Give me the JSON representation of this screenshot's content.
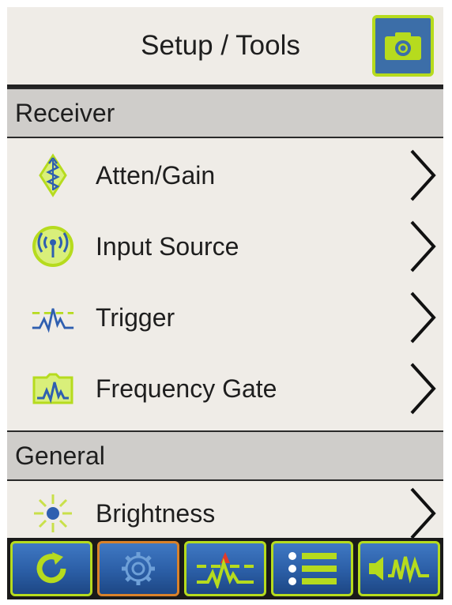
{
  "header": {
    "title": "Setup / Tools",
    "camera_icon": "camera-icon"
  },
  "sections": [
    {
      "label": "Receiver",
      "items": [
        {
          "label": "Atten/Gain",
          "icon": "atten-gain-icon"
        },
        {
          "label": "Input Source",
          "icon": "input-source-icon"
        },
        {
          "label": "Trigger",
          "icon": "trigger-icon"
        },
        {
          "label": "Frequency Gate",
          "icon": "frequency-gate-icon"
        }
      ]
    },
    {
      "label": "General",
      "items": [
        {
          "label": "Brightness",
          "icon": "brightness-icon"
        }
      ]
    }
  ],
  "toolbar": {
    "buttons": [
      {
        "icon": "refresh-icon",
        "active": false
      },
      {
        "icon": "gear-icon",
        "active": true
      },
      {
        "icon": "trigger-level-icon",
        "active": false
      },
      {
        "icon": "list-icon",
        "active": false
      },
      {
        "icon": "audio-waveform-icon",
        "active": false
      }
    ]
  },
  "colors": {
    "accent_green": "#b6db1e",
    "active_orange": "#d9822b",
    "icon_blue": "#2f5fb0",
    "background": "#efece7",
    "section_header": "#cfcdca"
  }
}
